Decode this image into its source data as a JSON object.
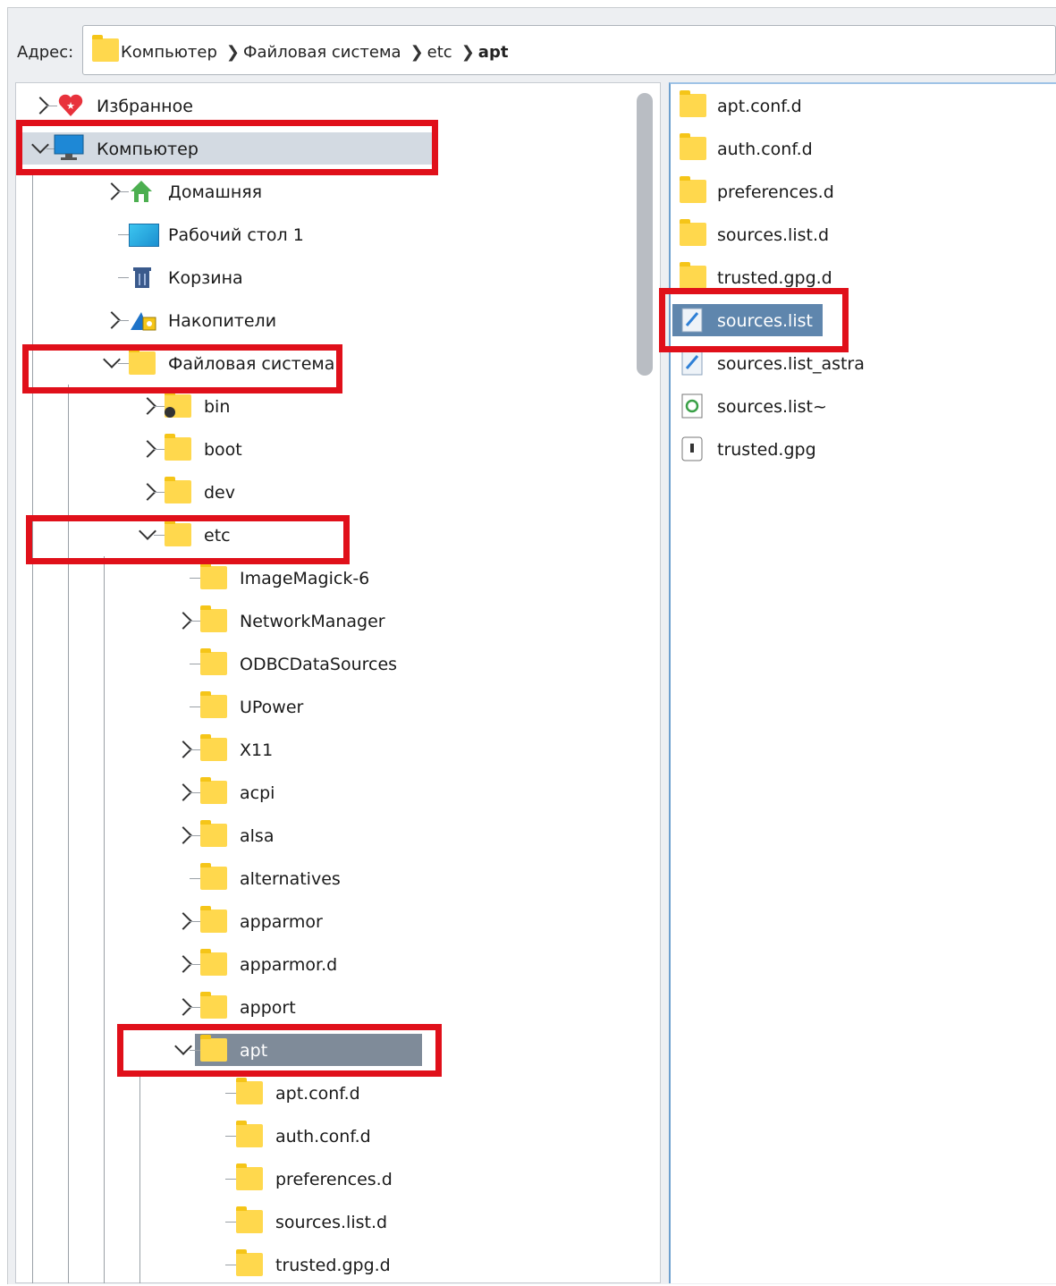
{
  "address": {
    "label": "Адрес:",
    "crumbs": [
      "Компьютер",
      "Файловая система",
      "etc",
      "apt"
    ]
  },
  "tree": {
    "items": [
      {
        "label": "Избранное",
        "icon": "heart-icon",
        "state": "collapsed"
      },
      {
        "label": "Компьютер",
        "icon": "monitor-icon",
        "state": "expanded",
        "selected": true
      },
      {
        "label": "Домашняя",
        "icon": "home-icon",
        "state": "collapsed"
      },
      {
        "label": "Рабочий стол 1",
        "icon": "desktop-icon",
        "state": "leaf"
      },
      {
        "label": "Корзина",
        "icon": "trash-icon",
        "state": "leaf"
      },
      {
        "label": "Накопители",
        "icon": "drives-icon",
        "state": "collapsed"
      },
      {
        "label": "Файловая система",
        "icon": "folder-icon",
        "state": "expanded"
      },
      {
        "label": "bin",
        "icon": "folder-link-icon",
        "state": "collapsed"
      },
      {
        "label": "boot",
        "icon": "folder-icon",
        "state": "collapsed"
      },
      {
        "label": "dev",
        "icon": "folder-icon",
        "state": "collapsed"
      },
      {
        "label": "etc",
        "icon": "folder-icon",
        "state": "expanded"
      },
      {
        "label": "ImageMagick-6",
        "icon": "folder-icon",
        "state": "leaf"
      },
      {
        "label": "NetworkManager",
        "icon": "folder-icon",
        "state": "collapsed"
      },
      {
        "label": "ODBCDataSources",
        "icon": "folder-icon",
        "state": "leaf"
      },
      {
        "label": "UPower",
        "icon": "folder-icon",
        "state": "leaf"
      },
      {
        "label": "X11",
        "icon": "folder-icon",
        "state": "collapsed"
      },
      {
        "label": "acpi",
        "icon": "folder-icon",
        "state": "collapsed"
      },
      {
        "label": "alsa",
        "icon": "folder-icon",
        "state": "collapsed"
      },
      {
        "label": "alternatives",
        "icon": "folder-icon",
        "state": "leaf"
      },
      {
        "label": "apparmor",
        "icon": "folder-icon",
        "state": "collapsed"
      },
      {
        "label": "apparmor.d",
        "icon": "folder-icon",
        "state": "collapsed"
      },
      {
        "label": "apport",
        "icon": "folder-icon",
        "state": "collapsed"
      },
      {
        "label": "apt",
        "icon": "folder-icon",
        "state": "expanded",
        "selected": true
      },
      {
        "label": "apt.conf.d",
        "icon": "folder-icon",
        "state": "leaf"
      },
      {
        "label": "auth.conf.d",
        "icon": "folder-icon",
        "state": "leaf"
      },
      {
        "label": "preferences.d",
        "icon": "folder-icon",
        "state": "leaf"
      },
      {
        "label": "sources.list.d",
        "icon": "folder-icon",
        "state": "leaf"
      },
      {
        "label": "trusted.gpg.d",
        "icon": "folder-icon",
        "state": "leaf"
      }
    ]
  },
  "files": {
    "items": [
      {
        "label": "apt.conf.d",
        "icon": "folder-icon"
      },
      {
        "label": "auth.conf.d",
        "icon": "folder-icon"
      },
      {
        "label": "preferences.d",
        "icon": "folder-icon"
      },
      {
        "label": "sources.list.d",
        "icon": "folder-icon"
      },
      {
        "label": "trusted.gpg.d",
        "icon": "folder-icon"
      },
      {
        "label": "sources.list",
        "icon": "text-file-icon",
        "selected": true
      },
      {
        "label": "sources.list_astra",
        "icon": "text-file-icon"
      },
      {
        "label": "sources.list~",
        "icon": "backup-file-icon"
      },
      {
        "label": "trusted.gpg",
        "icon": "key-file-icon"
      }
    ]
  },
  "colors": {
    "tree_selection": "#d3dae2",
    "apt_selection": "#7f8b99",
    "file_selection": "#5f86ad",
    "highlight_box": "#e0101a",
    "folder": "#ffd84d"
  }
}
